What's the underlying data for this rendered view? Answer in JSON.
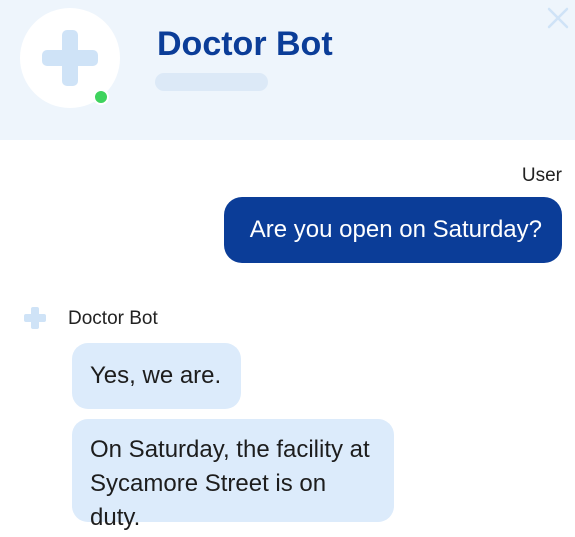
{
  "header": {
    "title": "Doctor Bot",
    "status": "online",
    "avatar_icon": "medical-cross-icon",
    "close_icon": "close-icon"
  },
  "colors": {
    "header_bg": "#eef5fc",
    "title": "#0b3d98",
    "user_bubble": "#0b3d98",
    "bot_bubble": "#dcebfb",
    "status_online": "#3ed35d"
  },
  "messages": [
    {
      "sender": "User",
      "text": "Are you open on Saturday?"
    },
    {
      "sender": "Doctor Bot",
      "bubbles": [
        "Yes, we are.",
        "On Saturday, the facility at Sycamore Street is on duty."
      ]
    }
  ]
}
